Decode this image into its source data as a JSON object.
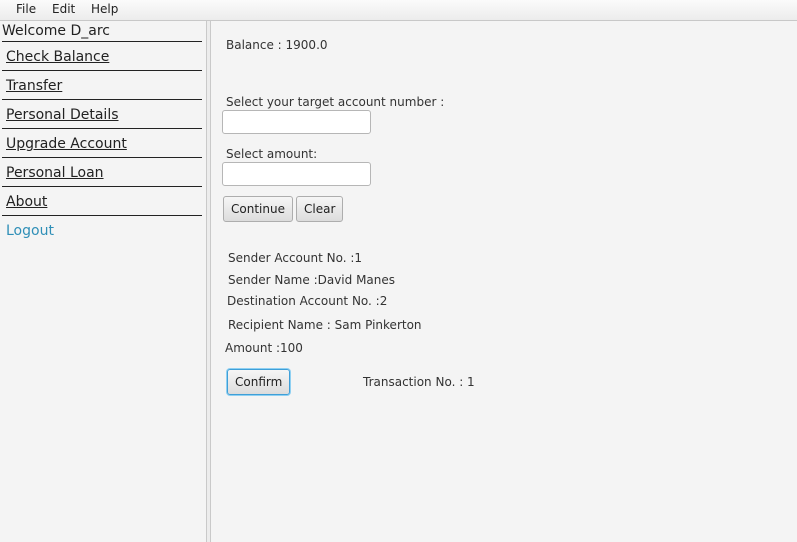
{
  "menubar": {
    "file": "File",
    "edit": "Edit",
    "help": "Help"
  },
  "sidebar": {
    "welcome": "Welcome D_arc",
    "items": [
      {
        "label": "Check Balance"
      },
      {
        "label": "Transfer"
      },
      {
        "label": "Personal Details"
      },
      {
        "label": "Upgrade Account"
      },
      {
        "label": "Personal Loan"
      },
      {
        "label": "About"
      },
      {
        "label": "Logout"
      }
    ]
  },
  "main": {
    "balance": "Balance : 1900.0",
    "target_label": "Select your target account number :",
    "target_value": "",
    "amount_label": "Select amount:",
    "amount_value": "",
    "continue_label": "Continue",
    "clear_label": "Clear",
    "sender_account": "Sender Account No. :1",
    "sender_name": "Sender Name :David Manes",
    "destination_account": "Destination Account No. :2",
    "recipient_name": "Recipient Name : Sam Pinkerton",
    "amount": "Amount :100",
    "confirm_label": "Confirm",
    "transaction_no": "Transaction No. : 1"
  },
  "colors": {
    "logout_link": "#2f8fb7",
    "focus_ring": "#3f9fd8"
  }
}
